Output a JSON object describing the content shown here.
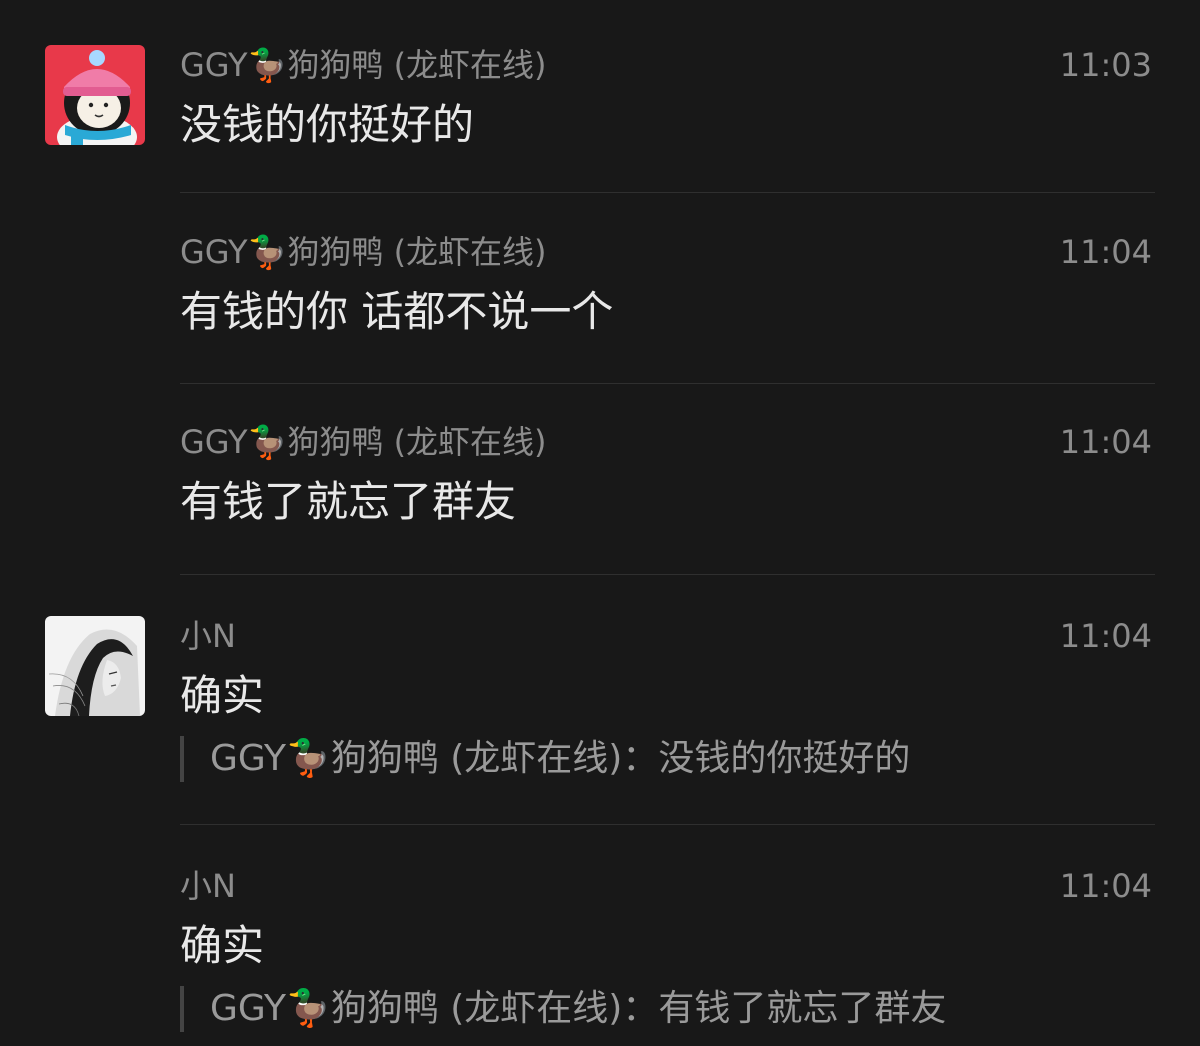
{
  "messages": [
    {
      "sender": "GGY🦆狗狗鸭 (龙虾在线)",
      "time": "11:03",
      "text": "没钱的你挺好的",
      "avatar": "penguin-avatar"
    },
    {
      "sender": "GGY🦆狗狗鸭 (龙虾在线)",
      "time": "11:04",
      "text": "有钱的你 话都不说一个"
    },
    {
      "sender": "GGY🦆狗狗鸭 (龙虾在线)",
      "time": "11:04",
      "text": "有钱了就忘了群友"
    },
    {
      "sender": "小N",
      "time": "11:04",
      "text": "确实",
      "quote": "GGY🦆狗狗鸭 (龙虾在线)：没钱的你挺好的",
      "avatar": "girl-sketch-avatar"
    },
    {
      "sender": "小N",
      "time": "11:04",
      "text": "确实",
      "quote": "GGY🦆狗狗鸭 (龙虾在线)：有钱了就忘了群友"
    }
  ],
  "colors": {
    "background": "#181818",
    "meta_text": "#8c8c8c",
    "message_text": "#e8e8e8",
    "quote_text": "#9a9a9a",
    "divider": "#2f2f2f"
  }
}
